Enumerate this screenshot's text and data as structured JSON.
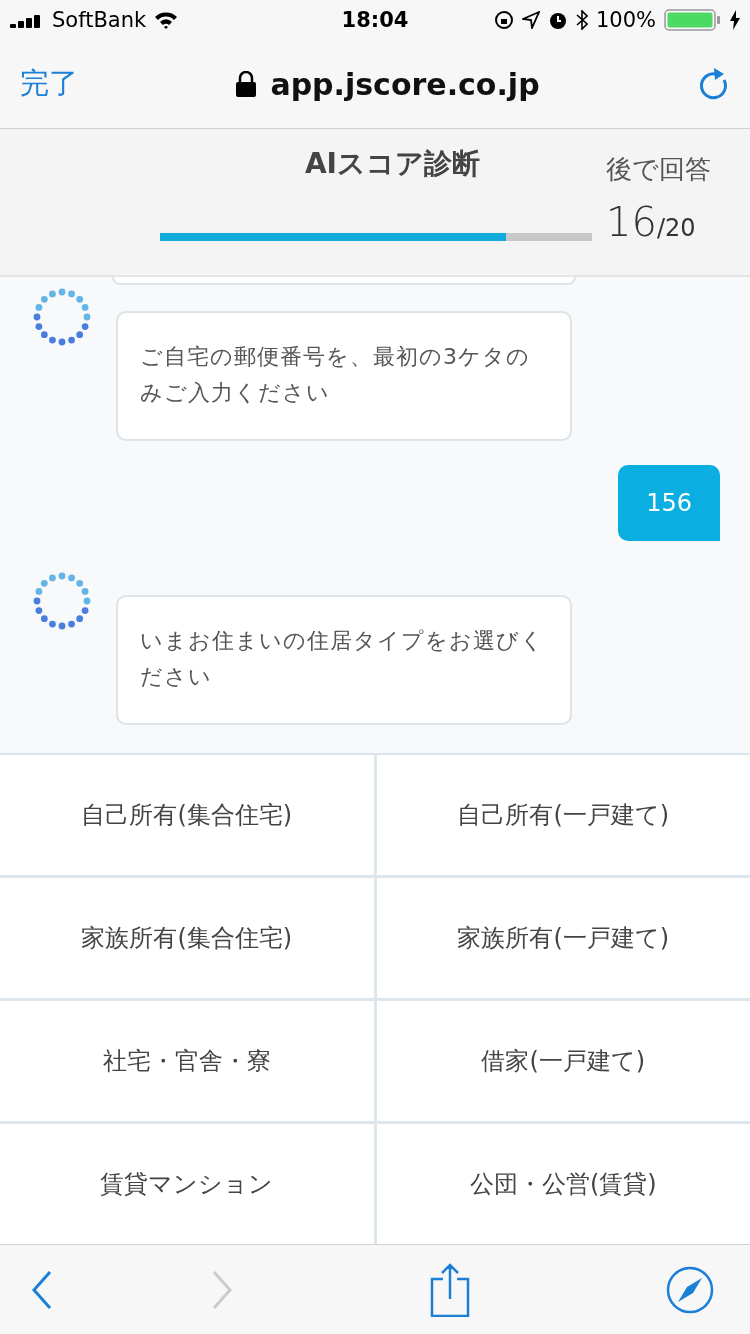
{
  "status_bar": {
    "carrier": "SoftBank",
    "time": "18:04",
    "battery": "100%"
  },
  "browser": {
    "done": "完了",
    "url": "app.jscore.co.jp"
  },
  "header": {
    "title": "AIスコア診断",
    "later": "後で回答",
    "progress": {
      "level": 0.8,
      "current": "16",
      "total": "/20"
    }
  },
  "messages": [
    {
      "kind": "bot",
      "text": "ご自宅の郵便番号を、最初の3ケタのみご入力ください"
    },
    {
      "kind": "user",
      "text": "156"
    },
    {
      "kind": "bot",
      "text": "いまお住まいの住居タイプをお選びください"
    }
  ],
  "options": [
    "自己所有(集合住宅)",
    "自己所有(一戸建て)",
    "家族所有(集合住宅)",
    "家族所有(一戸建て)",
    "社宅・官舎・寮",
    "借家(一戸建て)",
    "賃貸マンション",
    "公団・公営(賃貸)"
  ],
  "toolbar": {
    "back": {
      "disabled": false
    },
    "forward": {
      "disabled": true
    }
  }
}
